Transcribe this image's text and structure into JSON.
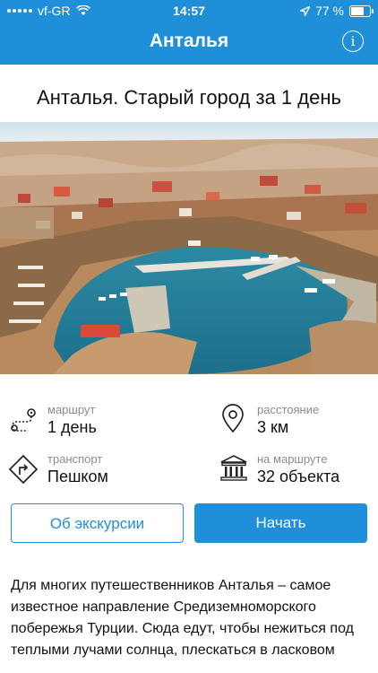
{
  "status_bar": {
    "carrier": "vf-GR",
    "time": "14:57",
    "battery": "77 %",
    "battery_level": 0.77
  },
  "nav": {
    "title": "Анталья",
    "info_icon": "info-icon"
  },
  "tour": {
    "title": "Анталья. Старый город за 1 день"
  },
  "stats": [
    {
      "label": "маршрут",
      "value": "1 день",
      "icon": "route-icon"
    },
    {
      "label": "расстояние",
      "value": "3 км",
      "icon": "location-pin-icon"
    },
    {
      "label": "транспорт",
      "value": "Пешком",
      "icon": "direction-sign-icon"
    },
    {
      "label": "на маршруте",
      "value": "32 объекта",
      "icon": "landmark-icon"
    }
  ],
  "buttons": {
    "about": "Об экскурсии",
    "start": "Начать"
  },
  "description": "Для многих путешественников Анталья – самое известное направление Средиземноморского побережья Турции. Сюда едут, чтобы нежиться под теплыми лучами солнца, плескаться в ласковом"
}
